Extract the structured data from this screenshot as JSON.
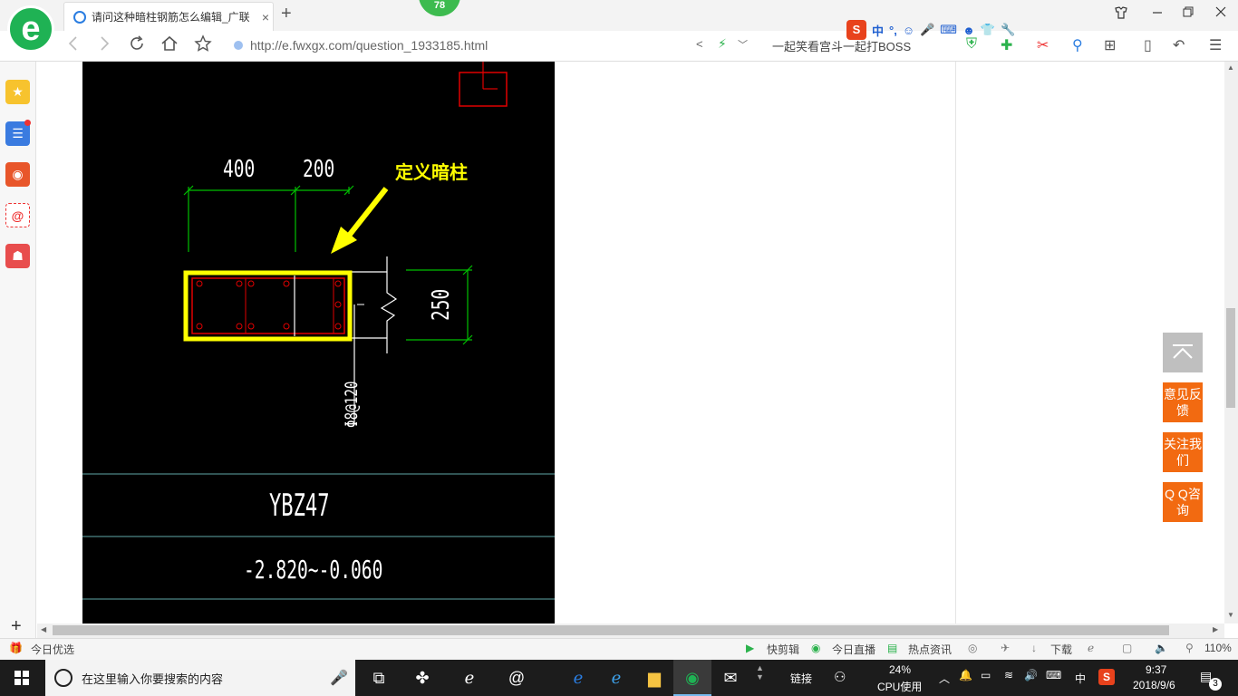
{
  "browser": {
    "tab_title": "请问这种暗柱钢筋怎么编辑_广联",
    "tab_close": "×",
    "new_tab": "+",
    "badge_count": "78",
    "url": "http://e.fwxgx.com/question_1933185.html",
    "search_text": "一起笑看宫斗一起打BOSS",
    "ime_label": "中",
    "ime_punct": "°,"
  },
  "cad": {
    "dim_400": "400",
    "dim_200": "200",
    "dim_250": "250",
    "callout": "定义暗柱",
    "rebar_spec": "Φ8@120",
    "label": "YBZ47",
    "elevation": "-2.820~-0.060"
  },
  "float_buttons": {
    "feedback": "意见反馈",
    "follow": "关注我们",
    "qq": "Q Q咨询"
  },
  "statusbar": {
    "left": "今日优选",
    "clip": "快剪辑",
    "live": "今日直播",
    "news": "热点资讯",
    "download": "下载",
    "zoom": "110%"
  },
  "taskbar": {
    "search_placeholder": "在这里输入你要搜索的内容",
    "links": "链接",
    "cpu_percent": "24%",
    "cpu_label": "CPU使用",
    "ime": "中",
    "time": "9:37",
    "date": "2018/9/6",
    "notif_count": "3"
  },
  "colors": {
    "cad_background": "#000000",
    "dimension_green": "#00c000",
    "highlight_yellow": "#ffff00",
    "column_red": "#e00000",
    "accent_orange": "#f26a11"
  }
}
